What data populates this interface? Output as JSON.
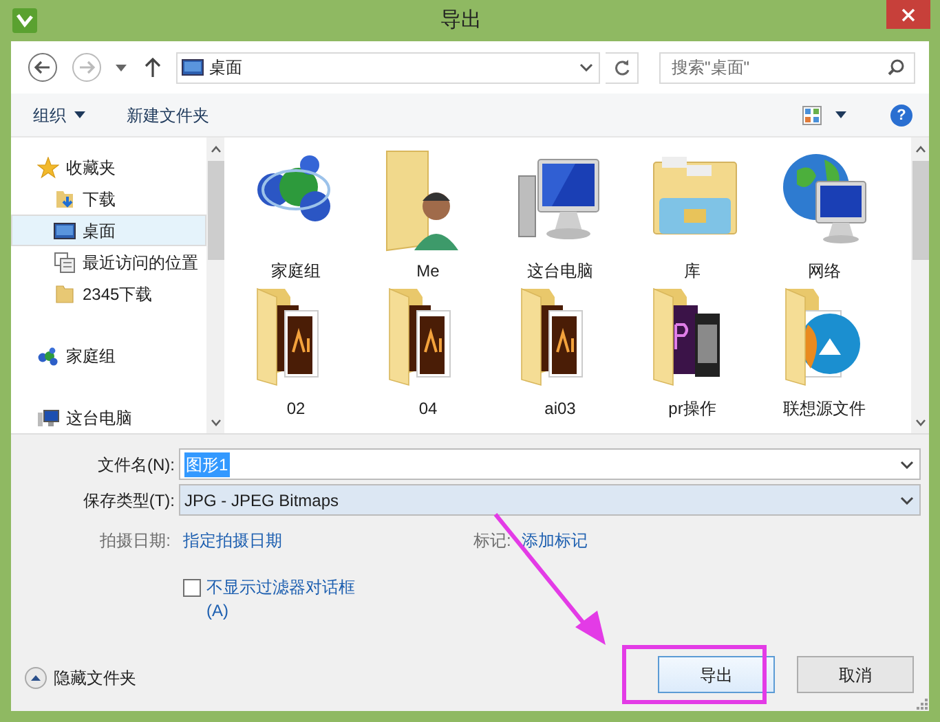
{
  "window": {
    "title": "导出"
  },
  "nav": {
    "location": "桌面",
    "search_placeholder": "搜索\"桌面\""
  },
  "toolbar": {
    "organize": "组织",
    "new_folder": "新建文件夹",
    "help": "?"
  },
  "sidebar": {
    "items": [
      {
        "label": "收藏夹",
        "kind": "star",
        "selected": false,
        "children": [
          {
            "label": "下载",
            "kind": "download",
            "selected": false
          },
          {
            "label": "桌面",
            "kind": "desktop",
            "selected": true
          },
          {
            "label": "最近访问的位置",
            "kind": "recent",
            "selected": false
          },
          {
            "label": "2345下载",
            "kind": "folder",
            "selected": false
          }
        ]
      },
      {
        "label": "家庭组",
        "kind": "homegroup",
        "selected": false
      },
      {
        "label": "这台电脑",
        "kind": "computer",
        "selected": false
      }
    ]
  },
  "files": [
    {
      "name": "家庭组",
      "kind": "homegroup"
    },
    {
      "name": "Me",
      "kind": "user-folder"
    },
    {
      "name": "这台电脑",
      "kind": "computer"
    },
    {
      "name": "库",
      "kind": "library"
    },
    {
      "name": "网络",
      "kind": "network"
    },
    {
      "name": "02",
      "kind": "ai-folder"
    },
    {
      "name": "04",
      "kind": "ai-folder"
    },
    {
      "name": "ai03",
      "kind": "ai-folder"
    },
    {
      "name": "pr操作",
      "kind": "pr-folder"
    },
    {
      "name": "联想源文件",
      "kind": "media-folder"
    }
  ],
  "form": {
    "file_name_label": "文件名(N):",
    "file_name": "图形1",
    "type_label": "保存类型(T):",
    "type": "JPG - JPEG Bitmaps",
    "date_label": "拍摄日期:",
    "date_link": "指定拍摄日期",
    "tags_label": "标记:",
    "tags_link": "添加标记",
    "filter_checkbox": {
      "label": "不显示过滤器对话框(A)",
      "checked": false
    }
  },
  "footer": {
    "hide_folders": "隐藏文件夹",
    "buttons": [
      "导出",
      "取消"
    ]
  }
}
